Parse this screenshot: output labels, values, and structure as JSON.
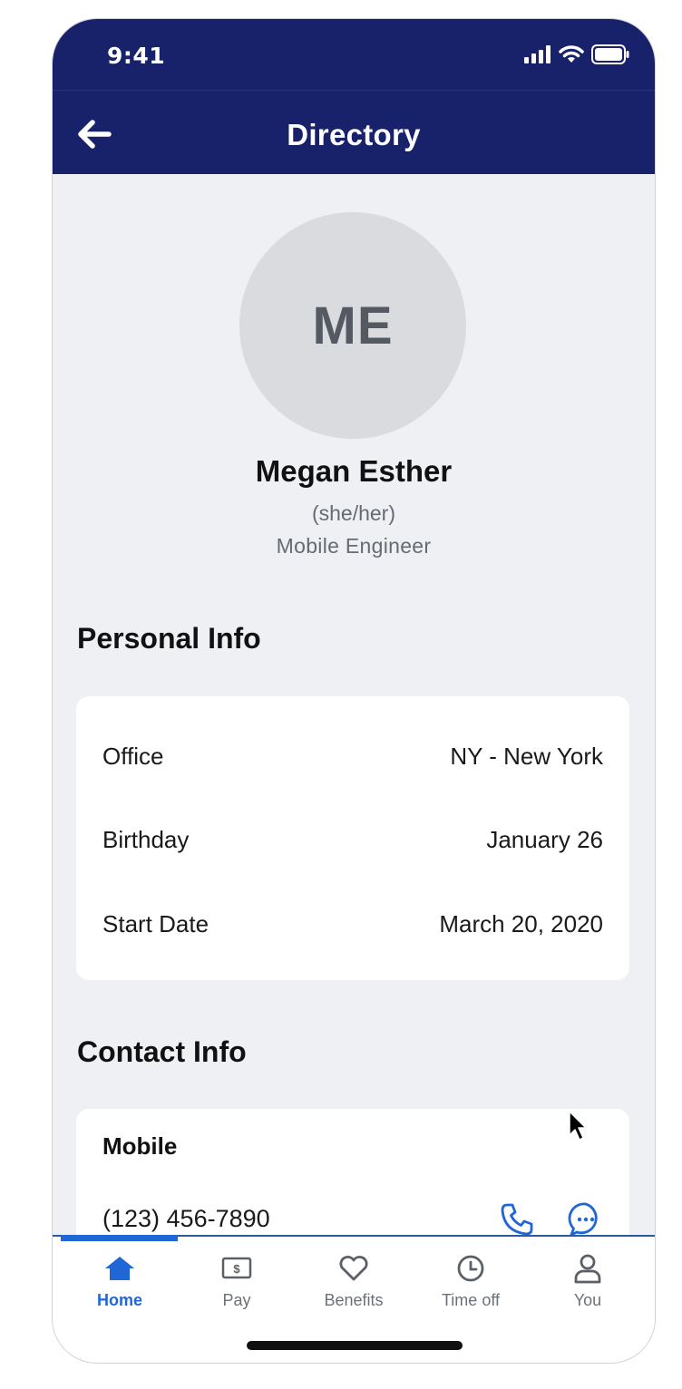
{
  "status_bar": {
    "time": "9:41"
  },
  "nav": {
    "title": "Directory"
  },
  "profile": {
    "initials": "ME",
    "name": "Megan Esther",
    "pronouns": "(she/her)",
    "role": "Mobile Engineer"
  },
  "personal_info": {
    "title": "Personal Info",
    "rows": [
      {
        "label": "Office",
        "value": "NY - New York"
      },
      {
        "label": "Birthday",
        "value": "January 26"
      },
      {
        "label": "Start Date",
        "value": "March 20, 2020"
      }
    ]
  },
  "contact_info": {
    "title": "Contact Info",
    "mobile_label": "Mobile",
    "mobile_number": "(123) 456-7890"
  },
  "tabs": [
    {
      "label": "Home",
      "icon": "home-icon",
      "active": true
    },
    {
      "label": "Pay",
      "icon": "pay-icon",
      "active": false
    },
    {
      "label": "Benefits",
      "icon": "heart-icon",
      "active": false
    },
    {
      "label": "Time off",
      "icon": "clock-icon",
      "active": false
    },
    {
      "label": "You",
      "icon": "person-icon",
      "active": false
    }
  ],
  "colors": {
    "header_bg": "#18226b",
    "accent": "#1f66d6",
    "page_bg": "#eff0f4"
  }
}
